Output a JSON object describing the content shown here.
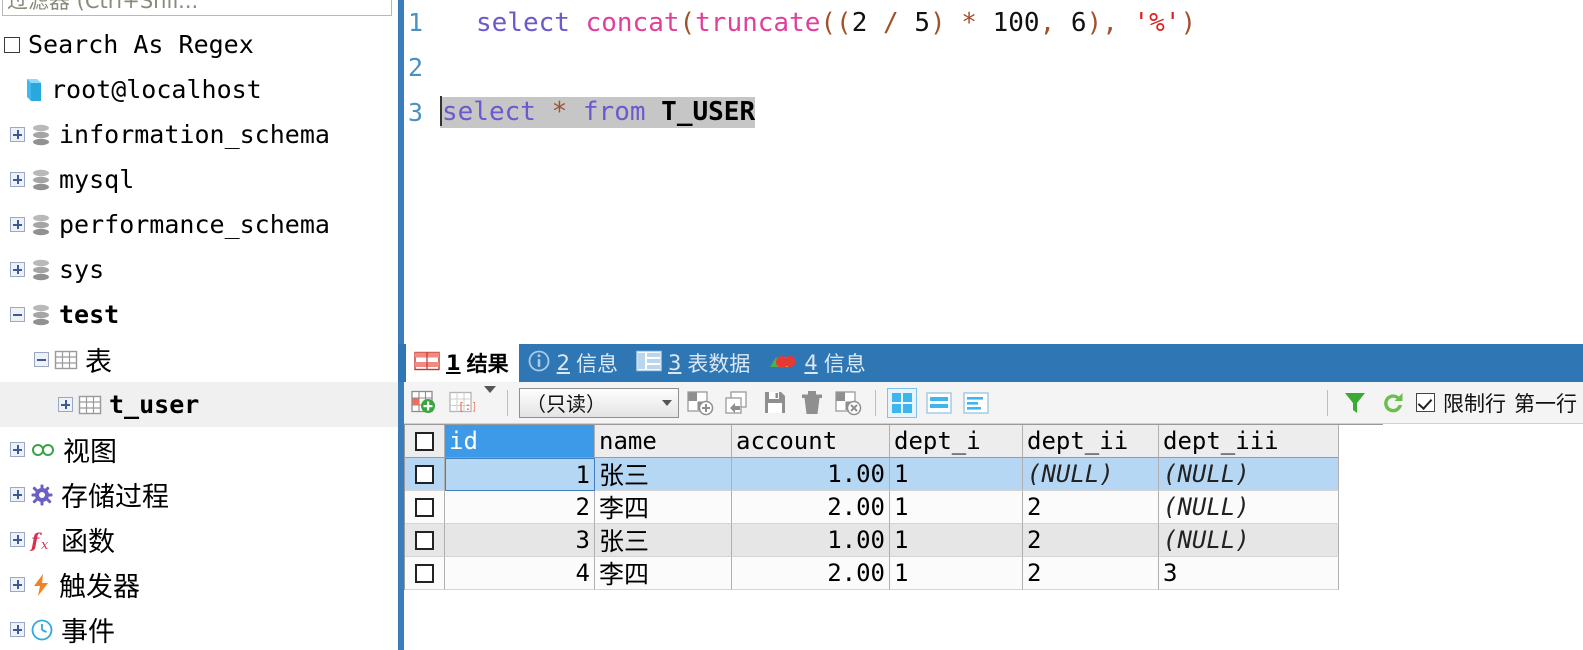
{
  "sidebar": {
    "filter_placeholder": "过滤器 (Ctrl+Shif...",
    "search_as_regex_label": "Search As Regex",
    "tree": [
      {
        "label": "root@localhost",
        "icon": "connection-icon",
        "indent": 0,
        "toggle": "none",
        "bold": false,
        "cjk": false,
        "selected": false
      },
      {
        "label": "information_schema",
        "icon": "database-icon",
        "indent": 1,
        "toggle": "plus",
        "bold": false,
        "cjk": false,
        "selected": false
      },
      {
        "label": "mysql",
        "icon": "database-icon",
        "indent": 1,
        "toggle": "plus",
        "bold": false,
        "cjk": false,
        "selected": false
      },
      {
        "label": "performance_schema",
        "icon": "database-icon",
        "indent": 1,
        "toggle": "plus",
        "bold": false,
        "cjk": false,
        "selected": false
      },
      {
        "label": "sys",
        "icon": "database-icon",
        "indent": 1,
        "toggle": "plus",
        "bold": false,
        "cjk": false,
        "selected": false
      },
      {
        "label": "test",
        "icon": "database-icon",
        "indent": 1,
        "toggle": "minus",
        "bold": true,
        "cjk": false,
        "selected": false
      },
      {
        "label": "表",
        "icon": "table-folder-icon",
        "indent": 2,
        "toggle": "minus",
        "bold": false,
        "cjk": true,
        "selected": false
      },
      {
        "label": "t_user",
        "icon": "table-icon",
        "indent": 3,
        "toggle": "plus",
        "bold": true,
        "cjk": false,
        "selected": true
      },
      {
        "label": "视图",
        "icon": "view-icon",
        "indent": 2,
        "toggle": "plus",
        "bold": false,
        "cjk": true,
        "selected": false
      },
      {
        "label": "存储过程",
        "icon": "procedure-icon",
        "indent": 2,
        "toggle": "plus",
        "bold": false,
        "cjk": true,
        "selected": false
      },
      {
        "label": "函数",
        "icon": "function-icon",
        "indent": 2,
        "toggle": "plus",
        "bold": false,
        "cjk": true,
        "selected": false
      },
      {
        "label": "触发器",
        "icon": "trigger-icon",
        "indent": 2,
        "toggle": "plus",
        "bold": false,
        "cjk": true,
        "selected": false
      },
      {
        "label": "事件",
        "icon": "event-icon",
        "indent": 2,
        "toggle": "plus",
        "bold": false,
        "cjk": true,
        "selected": false
      }
    ]
  },
  "editor": {
    "lines": [
      {
        "number": "1",
        "text": "select concat(truncate((2 / 5) * 100, 6), '%')"
      },
      {
        "number": "2",
        "text": ""
      },
      {
        "number": "3",
        "text": "select * from T_USER"
      }
    ],
    "line1_tokens": {
      "kw_select": "select",
      "fn_concat": "concat",
      "p_open1": "(",
      "fn_truncate": "truncate",
      "p_open2": "(",
      "p_open3": "(",
      "n2": "2",
      "op_div": "/",
      "n5": "5",
      "p_close1": ")",
      "op_mul": "*",
      "n100": "100",
      "comma1": ",",
      "n6": "6",
      "p_close2": ")",
      "comma2": ",",
      "s_pct": "'%'",
      "p_close3": ")"
    },
    "line3_tokens": {
      "kw_select": "select",
      "star": "*",
      "kw_from": "from",
      "table": "T_USER"
    }
  },
  "results": {
    "tabs": [
      {
        "num": "1",
        "label": "结果",
        "icon": "result-grid-icon",
        "active": true
      },
      {
        "num": "2",
        "label": "信息",
        "icon": "info-circle-icon",
        "active": false
      },
      {
        "num": "3",
        "label": "表数据",
        "icon": "table-data-icon",
        "active": false
      },
      {
        "num": "4",
        "label": "信息",
        "icon": "profile-chart-icon",
        "active": false
      }
    ],
    "toolbar": {
      "add_record_icon": "add-record-icon",
      "insert_null_icon": "insert-null-icon",
      "dropdown_icon": "chevron-down-icon",
      "mode_value": "（只读）",
      "apply_icon": "apply-changes-icon",
      "revert_icon": "revert-changes-icon",
      "save_icon": "save-icon",
      "delete_icon": "delete-row-icon",
      "cancel_icon": "cancel-edit-icon",
      "view_grid_icon": "grid-view-icon",
      "view_form_icon": "form-view-icon",
      "view_text_icon": "text-view-icon",
      "filter_icon": "filter-funnel-icon",
      "refresh_icon": "refresh-icon",
      "limit_rows_label": "限制行",
      "first_row_label": "第一行",
      "limit_checked": true
    },
    "grid": {
      "columns": [
        "id",
        "name",
        "account",
        "dept_i",
        "dept_ii",
        "dept_iii"
      ],
      "selected_column": "id",
      "rows": [
        {
          "id": "1",
          "name": "张三",
          "account": "1.00",
          "dept_i": "1",
          "dept_ii": "(NULL)",
          "dept_iii": "(NULL)",
          "state": "sel"
        },
        {
          "id": "2",
          "name": "李四",
          "account": "2.00",
          "dept_i": "1",
          "dept_ii": "2",
          "dept_iii": "(NULL)",
          "state": "plain"
        },
        {
          "id": "3",
          "name": "张三",
          "account": "1.00",
          "dept_i": "1",
          "dept_ii": "2",
          "dept_iii": "(NULL)",
          "state": "alt"
        },
        {
          "id": "4",
          "name": "李四",
          "account": "2.00",
          "dept_i": "1",
          "dept_ii": "2",
          "dept_iii": "3",
          "state": "plain"
        }
      ]
    }
  },
  "colors": {
    "tab_blue": "#2e76b4",
    "divider_blue": "#3b7cba",
    "header_select": "#3d9ae8",
    "row_select": "#b6d7f4",
    "keyword": "#6a5acd",
    "function": "#e0409a",
    "string": "#e02020",
    "punct": "#a0522d"
  }
}
